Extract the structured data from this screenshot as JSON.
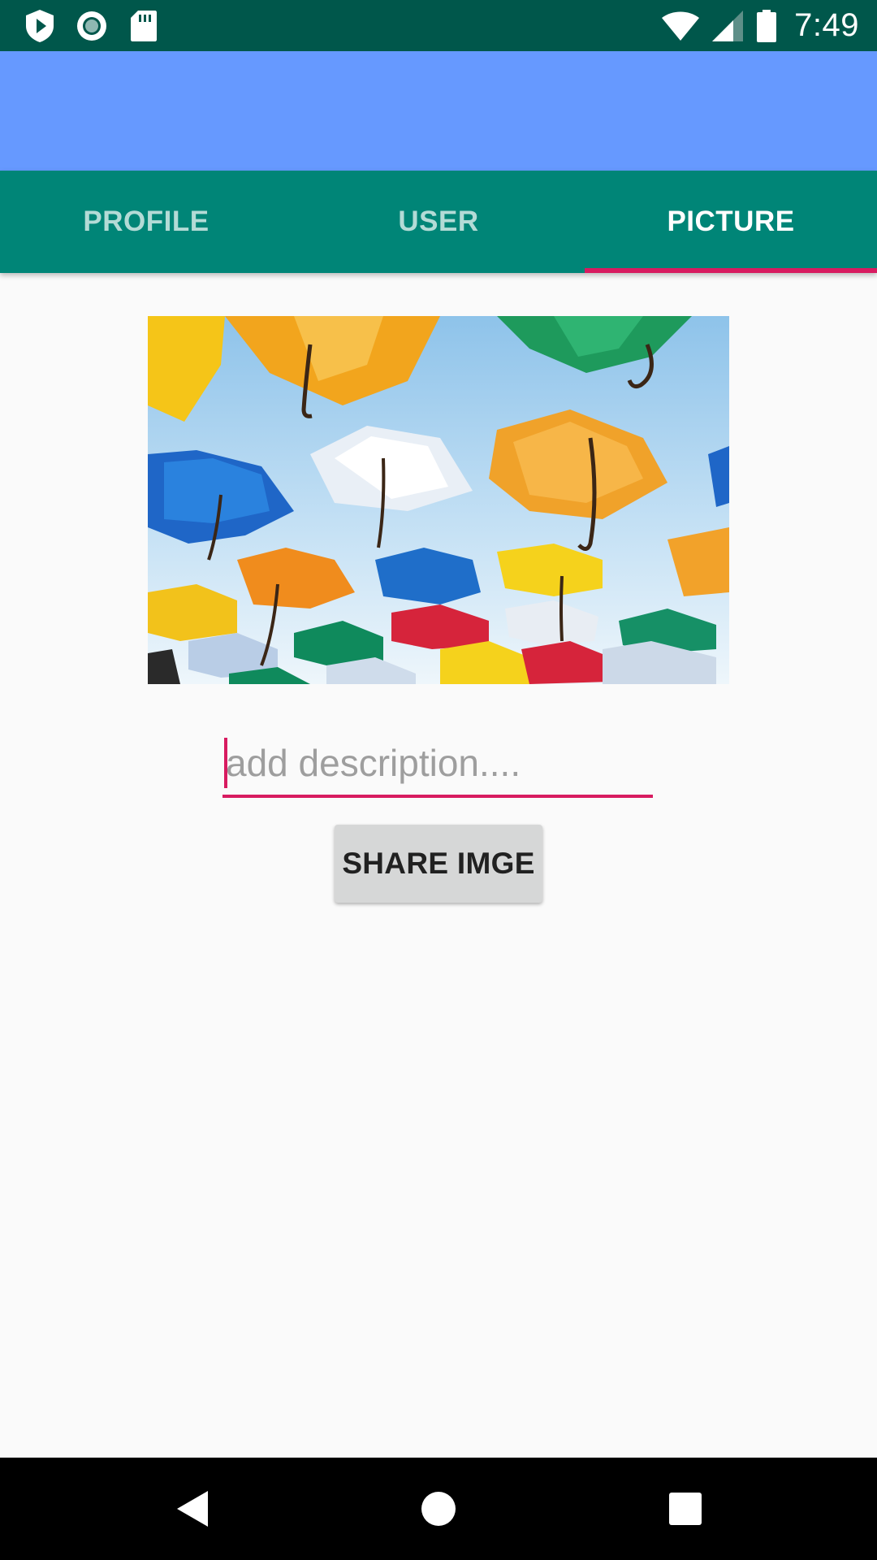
{
  "status_bar": {
    "time": "7:49",
    "left_icons": [
      "play-protect-icon",
      "circle-notification-icon",
      "sd-card-icon"
    ],
    "right_icons": [
      "wifi-icon",
      "cell-signal-icon",
      "battery-icon"
    ]
  },
  "colors": {
    "status_bar": "#00574b",
    "app_bar": "#6699ff",
    "tab_bar": "#008577",
    "accent": "#d81b60",
    "background": "#fafafa",
    "button": "#d6d7d7"
  },
  "tabs": [
    {
      "label": "PROFILE",
      "active": false
    },
    {
      "label": "USER",
      "active": false
    },
    {
      "label": "PICTURE",
      "active": true
    }
  ],
  "picture": {
    "description": "colorful umbrellas against a blue sky"
  },
  "description_input": {
    "placeholder": "add description....",
    "value": ""
  },
  "share_button": {
    "label": "SHARE IMGE"
  },
  "nav_bar": {
    "buttons": [
      "back-icon",
      "home-icon",
      "recents-icon"
    ]
  }
}
